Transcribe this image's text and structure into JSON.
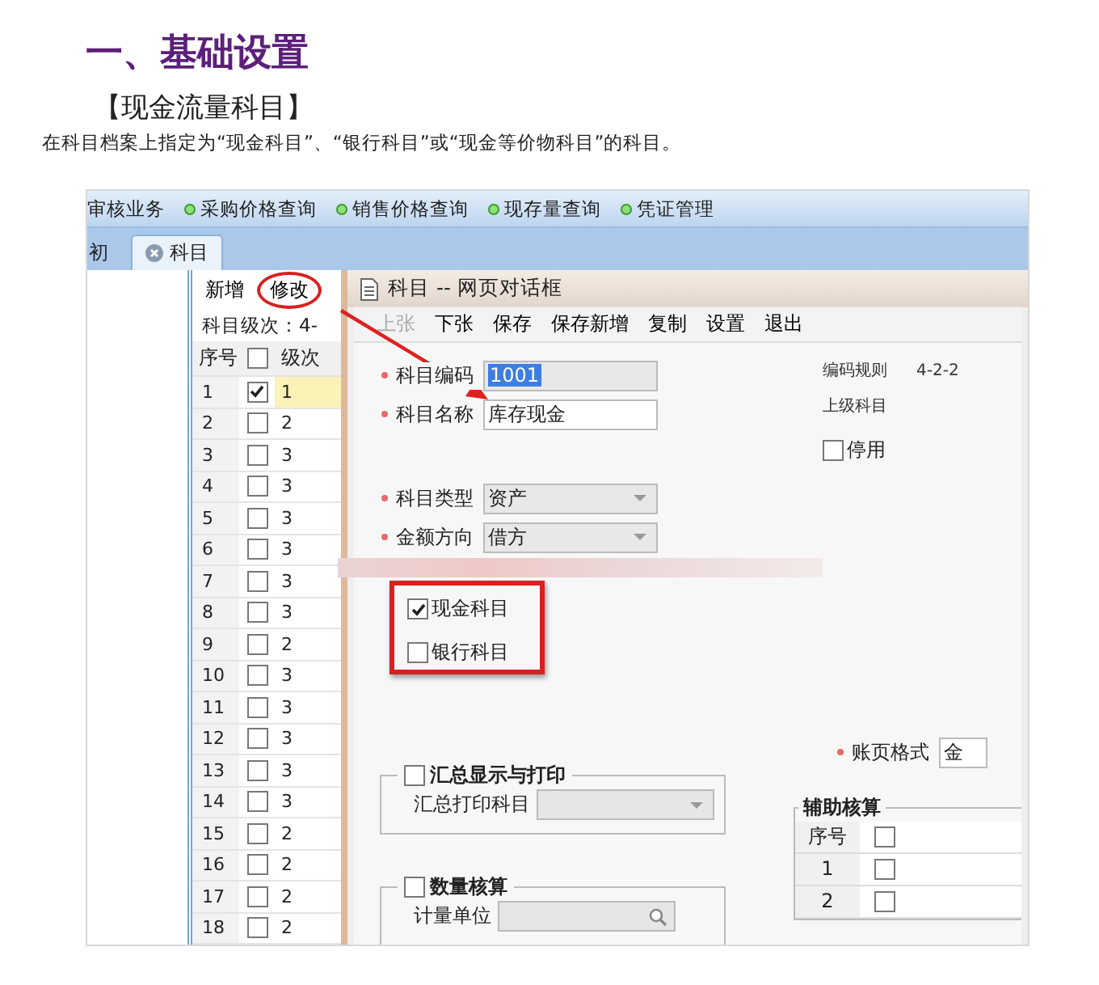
{
  "article": {
    "heading": "一、基础设置",
    "subheading": "【现金流量科目】",
    "description": "在科目档案上指定为“现金科目”、“银行科目”或“现金等价物科目”的科目。"
  },
  "screenshot": {
    "menu": [
      {
        "label": "审核业务",
        "bullet": false
      },
      {
        "label": "采购价格查询",
        "bullet": true
      },
      {
        "label": "销售价格查询",
        "bullet": true
      },
      {
        "label": "现存量查询",
        "bullet": true
      },
      {
        "label": "凭证管理",
        "bullet": true
      }
    ],
    "tabs": [
      {
        "label": "初",
        "selected": false,
        "closable": false
      },
      {
        "label": "科目",
        "selected": true,
        "closable": true
      }
    ],
    "list_panel": {
      "toolbar": [
        {
          "label": "新增",
          "circled": false
        },
        {
          "label": "修改",
          "circled": true
        }
      ],
      "level_rule": "科目级次：4-",
      "columns": [
        "序号",
        "级次"
      ],
      "header_checked": false,
      "rows": [
        {
          "no": "1",
          "checked": true,
          "level": "1",
          "selected": true
        },
        {
          "no": "2",
          "checked": false,
          "level": "2",
          "selected": false
        },
        {
          "no": "3",
          "checked": false,
          "level": "3",
          "selected": false
        },
        {
          "no": "4",
          "checked": false,
          "level": "3",
          "selected": false
        },
        {
          "no": "5",
          "checked": false,
          "level": "3",
          "selected": false
        },
        {
          "no": "6",
          "checked": false,
          "level": "3",
          "selected": false
        },
        {
          "no": "7",
          "checked": false,
          "level": "3",
          "selected": false
        },
        {
          "no": "8",
          "checked": false,
          "level": "3",
          "selected": false
        },
        {
          "no": "9",
          "checked": false,
          "level": "2",
          "selected": false
        },
        {
          "no": "10",
          "checked": false,
          "level": "3",
          "selected": false
        },
        {
          "no": "11",
          "checked": false,
          "level": "3",
          "selected": false
        },
        {
          "no": "12",
          "checked": false,
          "level": "3",
          "selected": false
        },
        {
          "no": "13",
          "checked": false,
          "level": "3",
          "selected": false
        },
        {
          "no": "14",
          "checked": false,
          "level": "3",
          "selected": false
        },
        {
          "no": "15",
          "checked": false,
          "level": "2",
          "selected": false
        },
        {
          "no": "16",
          "checked": false,
          "level": "2",
          "selected": false
        },
        {
          "no": "17",
          "checked": false,
          "level": "2",
          "selected": false
        },
        {
          "no": "18",
          "checked": false,
          "level": "2",
          "selected": false
        }
      ]
    },
    "dialog": {
      "title": "科目 -- 网页对话框",
      "toolbar": [
        {
          "label": "上张",
          "disabled": true
        },
        {
          "label": "下张",
          "disabled": false
        },
        {
          "label": "保存",
          "disabled": false
        },
        {
          "label": "保存新增",
          "disabled": false
        },
        {
          "label": "复制",
          "disabled": false
        },
        {
          "label": "设置",
          "disabled": false
        },
        {
          "label": "退出",
          "disabled": false
        }
      ],
      "fields": [
        {
          "kind": "readonly",
          "label": "科目编码",
          "value": "1001",
          "required": true
        },
        {
          "kind": "text",
          "label": "科目名称",
          "value": "库存现金",
          "required": true
        },
        {
          "kind": "select",
          "label": "科目类型",
          "value": "资产",
          "required": true
        },
        {
          "kind": "select",
          "label": "金额方向",
          "value": "借方",
          "required": true
        }
      ],
      "info": [
        {
          "label": "编码规则",
          "value": "4-2-2"
        },
        {
          "label": "上级科目"
        }
      ],
      "inactive": {
        "label": "停用",
        "checked": false
      },
      "subject_flags": [
        {
          "label": "现金科目",
          "checked": true
        },
        {
          "label": "银行科目",
          "checked": false
        }
      ],
      "summary_group": {
        "label": "汇总显示与打印",
        "checked": false,
        "field_label": "汇总打印科目"
      },
      "quantity_group": {
        "label": "数量核算",
        "checked": false,
        "field_label": "计量单位"
      },
      "ledger_format": {
        "label": "账页格式",
        "value": "金",
        "required": true
      },
      "auxiliary": {
        "title": "辅助核算",
        "columns": [
          "序号"
        ],
        "header_checked": false,
        "rows": [
          {
            "no": "1",
            "checked": false
          },
          {
            "no": "2",
            "checked": false
          }
        ]
      }
    }
  }
}
